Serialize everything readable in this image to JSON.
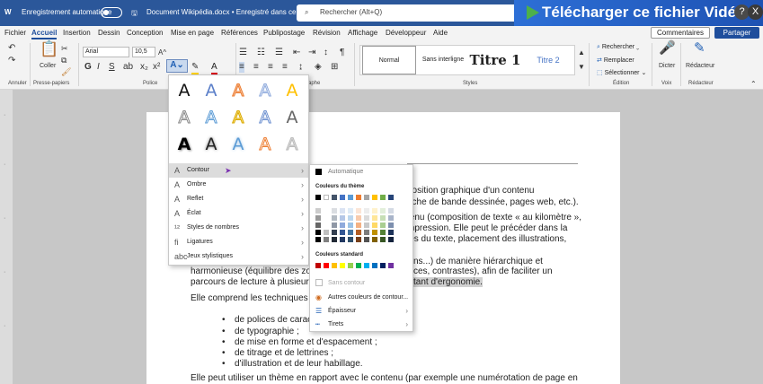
{
  "titlebar": {
    "autosave_label": "Enregistrement automatique",
    "doc_title": "Document Wikipédia.docx • Enregistré dans ce PC ⌄",
    "search_placeholder": "Rechercher (Alt+Q)",
    "banner_text": "Télécharger ce fichier Vidéo",
    "help": "?",
    "close": "X"
  },
  "tabs": [
    "Fichier",
    "Accueil",
    "Insertion",
    "Dessin",
    "Conception",
    "Mise en page",
    "Références",
    "Publipostage",
    "Révision",
    "Affichage",
    "Développeur",
    "Aide"
  ],
  "tabs_active": "Accueil",
  "comments_label": "Commentaires",
  "share_label": "Partager",
  "ribbon": {
    "groups": [
      "Annuler",
      "Presse-papiers",
      "Police",
      "Paragraphe",
      "Styles",
      "Édition",
      "Voix",
      "Rédacteur"
    ],
    "paste_label": "Coller",
    "font_name": "Arial",
    "font_size": "10,5",
    "styles": [
      "Normal",
      "Sans interligne",
      "Titre 1",
      "Titre 2"
    ],
    "edit_items": [
      "Rechercher",
      "Remplacer",
      "Sélectionner"
    ],
    "dictate_label": "Dicter",
    "editor_label": "Rédacteur"
  },
  "effects_menu": {
    "items": [
      "Contour",
      "Ombre",
      "Reflet",
      "Éclat",
      "Styles de nombres",
      "Ligatures",
      "Jeux stylistiques"
    ],
    "gallery_glyph": "A"
  },
  "contour_menu": {
    "automatic": "Automatique",
    "theme_colors_label": "Couleurs du thème",
    "standard_colors_label": "Couleurs standard",
    "no_outline": "Sans contour",
    "more_colors": "Autres couleurs de contour...",
    "weight": "Épaisseur",
    "dashes": "Tirets",
    "theme_top": [
      "#000000",
      "#ffffff",
      "#44546a",
      "#4472c4",
      "#5b9bd5",
      "#ed7d31",
      "#a5a5a5",
      "#ffc000",
      "#70ad47",
      "#264478"
    ],
    "standard": [
      "#c00000",
      "#ff0000",
      "#ffc000",
      "#ffff00",
      "#92d050",
      "#00b050",
      "#00b0f0",
      "#0070c0",
      "#002060",
      "#7030a0"
    ]
  },
  "document": {
    "lines": [
      "position graphique d'un contenu",
      "nche de bande dessinée, pages web, etc.).",
      "tenu (composition de texte « au kilomètre »,",
      "mpression. Elle peut le précéder dans la",
      "les du texte, placement des illustrations,",
      "ns...) de manière hiérarchique et",
      "harmonieuse (équilibre des zon",
      "ces, contrastes), afin de faciliter un",
      "parcours de lecture à plusieurs",
      "tant d'ergonomie.",
      "Elle comprend les techniques :",
      "Elle peut utiliser un thème en rapport avec le contenu (par exemple une numérotation de page en"
    ],
    "bullets": [
      "de polices de caract",
      "de typographie ;",
      "de mise en forme et d'espacement ;",
      "de titrage et de lettrines ;",
      "d'illustration et de leur habillage."
    ]
  }
}
